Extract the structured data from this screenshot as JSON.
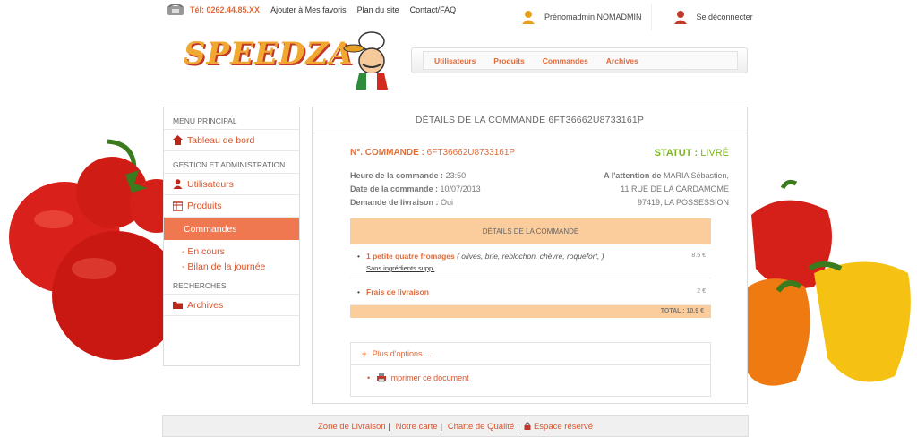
{
  "topbar": {
    "tel": "Tél: 0262.44.85.XX",
    "links": [
      "Ajouter à Mes favoris",
      "Plan du site",
      "Contact/FAQ"
    ]
  },
  "user": {
    "name": "Prénomadmin NOMADMIN",
    "logout": "Se déconnecter"
  },
  "logo": {
    "text": "SPEEDZA"
  },
  "nav": [
    "Utilisateurs",
    "Produits",
    "Commandes",
    "Archives"
  ],
  "sidebar": {
    "menu_head": "MENU PRINCIPAL",
    "dashboard": "Tableau de bord",
    "admin_head": "GESTION ET ADMINISTRATION",
    "users": "Utilisateurs",
    "products": "Produits",
    "orders": "Commandes",
    "sub_current": "- En cours",
    "sub_report": "- Bilan de la journée",
    "search_head": "RECHERCHES",
    "archives": "Archives"
  },
  "order": {
    "title": "DÉTAILS DE LA COMMANDE 6FT36662U8733161P",
    "number_label": "N°. COMMANDE :",
    "number": "6FT36662U8733161P",
    "status_label": "STATUT :",
    "status": "LIVRÉ",
    "hour_label": "Heure de la commande :",
    "hour": "23:50",
    "date_label": "Date de la commande :",
    "date": "10/07/2013",
    "delivery_label": "Demande de livraison :",
    "delivery": "Oui",
    "attention_label": "A l'attention de",
    "customer": "MARIA Sébastien,",
    "street": "11 RUE DE LA CARDAMOME",
    "city": "97419, LA POSSESSION",
    "details_head": "DÉTAILS DE LA COMMANDE",
    "items": [
      {
        "name": "1 petite quatre fromages",
        "ingredients": "( olives, brie, reblochon, chèvre, roquefort, )",
        "supp": "Sans ingrédients supp.",
        "price": "8.5 €"
      }
    ],
    "delivery_fee_label": "Frais de livraison",
    "delivery_fee": "2 €",
    "total": "TOTAL : 10.9 €",
    "more_options": "Plus d'options ...",
    "print": "Imprimer ce document"
  },
  "footer": {
    "links": [
      "Zone de Livraison",
      "Notre carte",
      "Charte de Qualité",
      "Espace réservé"
    ]
  },
  "colors": {
    "accent": "#e06a3a",
    "active": "#f07850",
    "status": "#7ab51d",
    "details_bg": "#fbcc9c"
  }
}
